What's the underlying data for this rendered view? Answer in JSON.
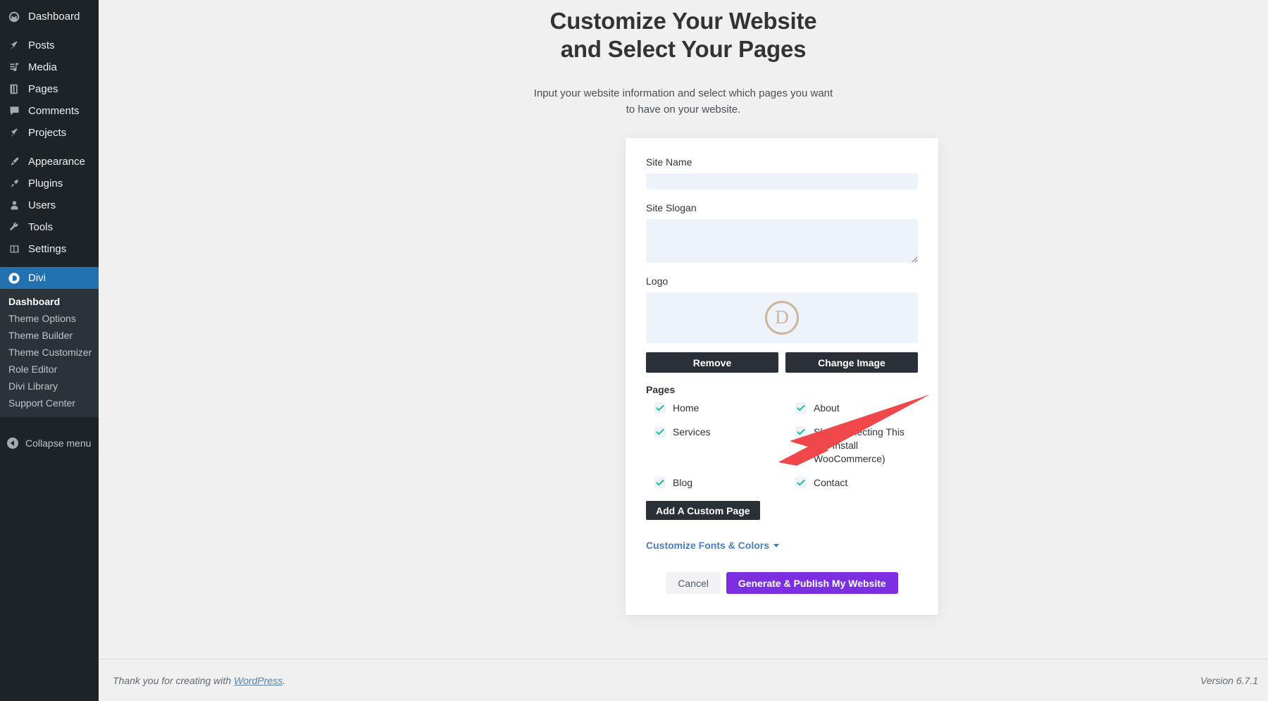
{
  "sidebar": {
    "items": [
      {
        "label": "Dashboard",
        "icon": "dashboard-icon",
        "active": false
      },
      {
        "label": "Posts",
        "icon": "pin-icon",
        "active": false
      },
      {
        "label": "Media",
        "icon": "media-icon",
        "active": false
      },
      {
        "label": "Pages",
        "icon": "pages-icon",
        "active": false
      },
      {
        "label": "Comments",
        "icon": "comments-icon",
        "active": false
      },
      {
        "label": "Projects",
        "icon": "pin-icon",
        "active": false
      },
      {
        "label": "Appearance",
        "icon": "brush-icon",
        "active": false
      },
      {
        "label": "Plugins",
        "icon": "plug-icon",
        "active": false
      },
      {
        "label": "Users",
        "icon": "user-icon",
        "active": false
      },
      {
        "label": "Tools",
        "icon": "wrench-icon",
        "active": false
      },
      {
        "label": "Settings",
        "icon": "settings-icon",
        "active": false
      },
      {
        "label": "Divi",
        "icon": "divi-icon",
        "active": true
      }
    ],
    "submenu": [
      {
        "label": "Dashboard",
        "current": true
      },
      {
        "label": "Theme Options",
        "current": false
      },
      {
        "label": "Theme Builder",
        "current": false
      },
      {
        "label": "Theme Customizer",
        "current": false
      },
      {
        "label": "Role Editor",
        "current": false
      },
      {
        "label": "Divi Library",
        "current": false
      },
      {
        "label": "Support Center",
        "current": false
      }
    ],
    "collapse_label": "Collapse menu"
  },
  "header": {
    "title": "Customize Your Website and Select Your Pages",
    "subtitle": "Input your website information and select which pages you want to have on your website."
  },
  "form": {
    "site_name": {
      "label": "Site Name",
      "value": "",
      "placeholder": ""
    },
    "site_slogan": {
      "label": "Site Slogan",
      "value": "",
      "placeholder": ""
    },
    "logo": {
      "label": "Logo",
      "glyph": "D",
      "remove_label": "Remove",
      "change_label": "Change Image"
    },
    "pages": {
      "label": "Pages",
      "items": [
        {
          "label": "Home",
          "checked": true
        },
        {
          "label": "About",
          "checked": true
        },
        {
          "label": "Services",
          "checked": true
        },
        {
          "label": "Shop (Selecting This Will Install WooCommerce)",
          "checked": true
        },
        {
          "label": "Blog",
          "checked": true
        },
        {
          "label": "Contact",
          "checked": true
        }
      ],
      "add_custom_page_label": "Add A Custom Page"
    },
    "fonts_colors_label": "Customize Fonts & Colors",
    "cancel_label": "Cancel",
    "publish_label": "Generate & Publish My Website"
  },
  "footer": {
    "thanks_prefix": "Thank you for creating with ",
    "wordpress_link": "WordPress",
    "thanks_suffix": ".",
    "version": "Version 6.7.1"
  },
  "colors": {
    "sidebar_bg": "#1d2327",
    "submenu_bg": "#2c3338",
    "active_menu": "#2271b1",
    "input_bg": "#eef2fb",
    "dark_button": "#2b2f38",
    "publish_button": "#7b2fe0",
    "check_green": "#1fbf8f",
    "link_blue": "#4a7ebb",
    "logo_tan": "#cbb69b",
    "annotation_red": "#f0484a"
  }
}
